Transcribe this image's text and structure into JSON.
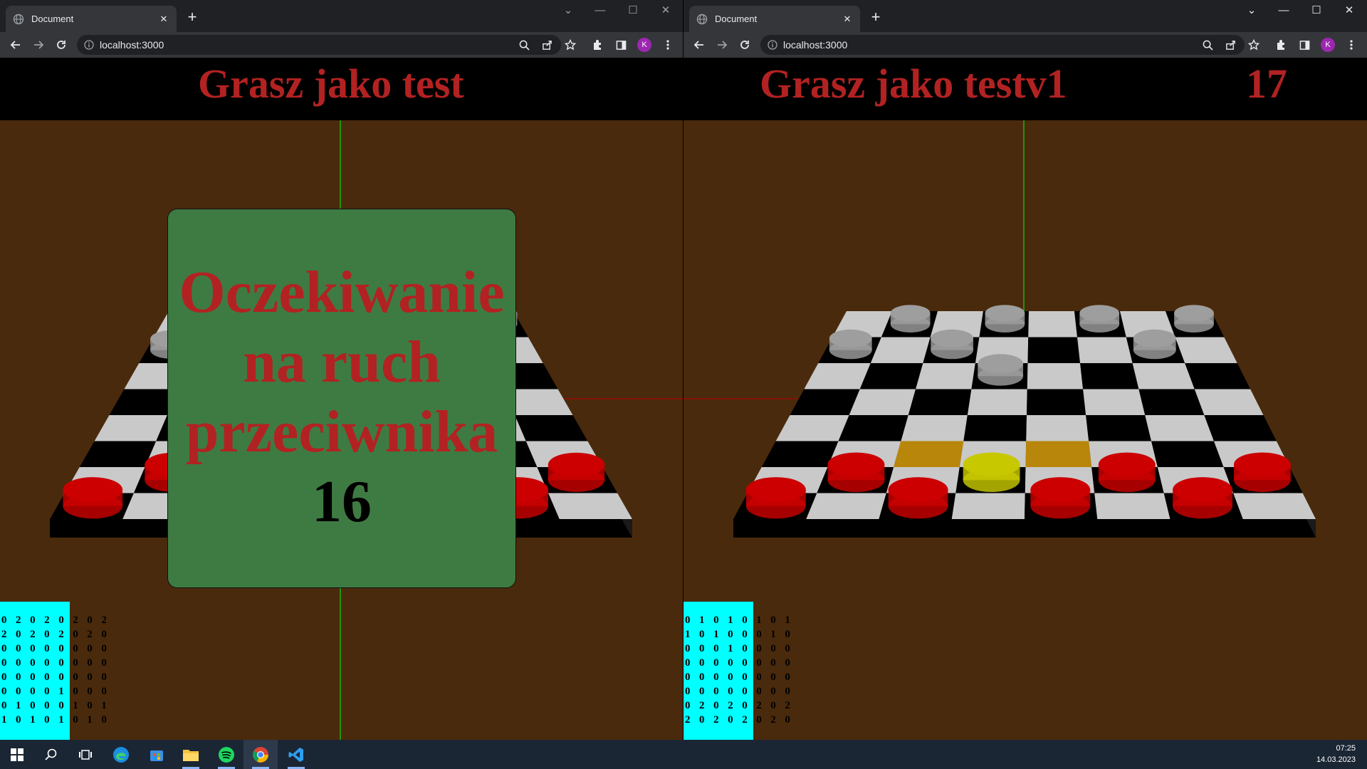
{
  "left_window": {
    "tab": {
      "title": "Document",
      "favicon": "globe-icon"
    },
    "omnibox": {
      "url": "localhost:3000"
    },
    "profile_initial": "K",
    "game": {
      "title": "Grasz jako test",
      "overlay": {
        "message_lines": [
          "Oczekiwanie",
          "na ruch",
          "przeciwnika"
        ],
        "countdown": "16"
      },
      "board_matrix": [
        "0 2 0 2 0 2 0 2",
        "2 0 2 0 2 0 2 0",
        "0 0 0 0 0 0 0 0",
        "0 0 0 0 0 0 0 0",
        "0 0 0 0 0 0 0 0",
        "0 0 0 0 1 0 0 0",
        "0 1 0 0 0 1 0 1",
        "1 0 1 0 1 0 1 0"
      ]
    }
  },
  "right_window": {
    "tab": {
      "title": "Document",
      "favicon": "globe-icon"
    },
    "omnibox": {
      "url": "localhost:3000"
    },
    "profile_initial": "K",
    "game": {
      "title": "Grasz jako testv1",
      "timer": "17",
      "board_matrix": [
        "0 1 0 1 0 1 0 1",
        "1 0 1 0 0 0 1 0",
        "0 0 0 1 0 0 0 0",
        "0 0 0 0 0 0 0 0",
        "0 0 0 0 0 0 0 0",
        "0 0 0 0 0 0 0 0",
        "0 2 0 2 0 2 0 2",
        "2 0 2 0 2 0 2 0"
      ]
    }
  },
  "colors": {
    "red_piece": "#cc0000",
    "grey_piece": "#9e9e9e",
    "selected_piece": "#c8c800",
    "highlight_square": "#b8860b",
    "background": "#4a2a0c",
    "title_text": "#b22222",
    "overlay_bg": "#3e7b43",
    "matrix_bg": "#00ffff"
  },
  "taskbar": {
    "icons": [
      "windows-start-icon",
      "search-icon",
      "task-view-icon",
      "edge-icon",
      "store-icon",
      "file-explorer-icon",
      "spotify-icon",
      "chrome-icon",
      "vscode-icon"
    ],
    "time": "07:25",
    "date": "14.03.2023"
  }
}
